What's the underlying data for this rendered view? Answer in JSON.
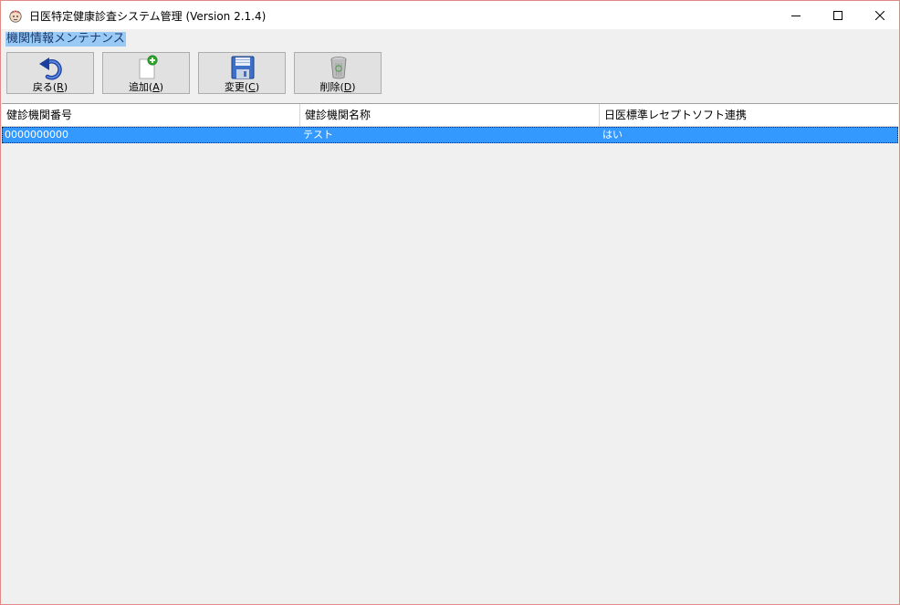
{
  "window": {
    "title": "日医特定健康診査システム管理 (Version 2.1.4)",
    "app_icon": "doctor-face-icon"
  },
  "screen_label": "機関情報メンテナンス",
  "toolbar": {
    "back": {
      "text": "戻る(",
      "accel": "R",
      "close": ")",
      "icon": "undo-arrow-icon"
    },
    "add": {
      "text": "追加(",
      "accel": "A",
      "close": ")",
      "icon": "new-document-icon"
    },
    "change": {
      "text": "変更(",
      "accel": "C",
      "close": ")",
      "icon": "floppy-disk-icon"
    },
    "delete": {
      "text": "削除(",
      "accel": "D",
      "close": ")",
      "icon": "trash-can-icon"
    }
  },
  "grid": {
    "columns": [
      "健診機関番号",
      "健診機関名称",
      "日医標準レセプトソフト連携"
    ],
    "rows": [
      {
        "number": "0000000000",
        "name": "テスト",
        "orca_link": "はい"
      }
    ]
  },
  "colors": {
    "selection": "#3399ff",
    "label_highlight": "#99c9f5",
    "window_border": "#e08a85"
  }
}
